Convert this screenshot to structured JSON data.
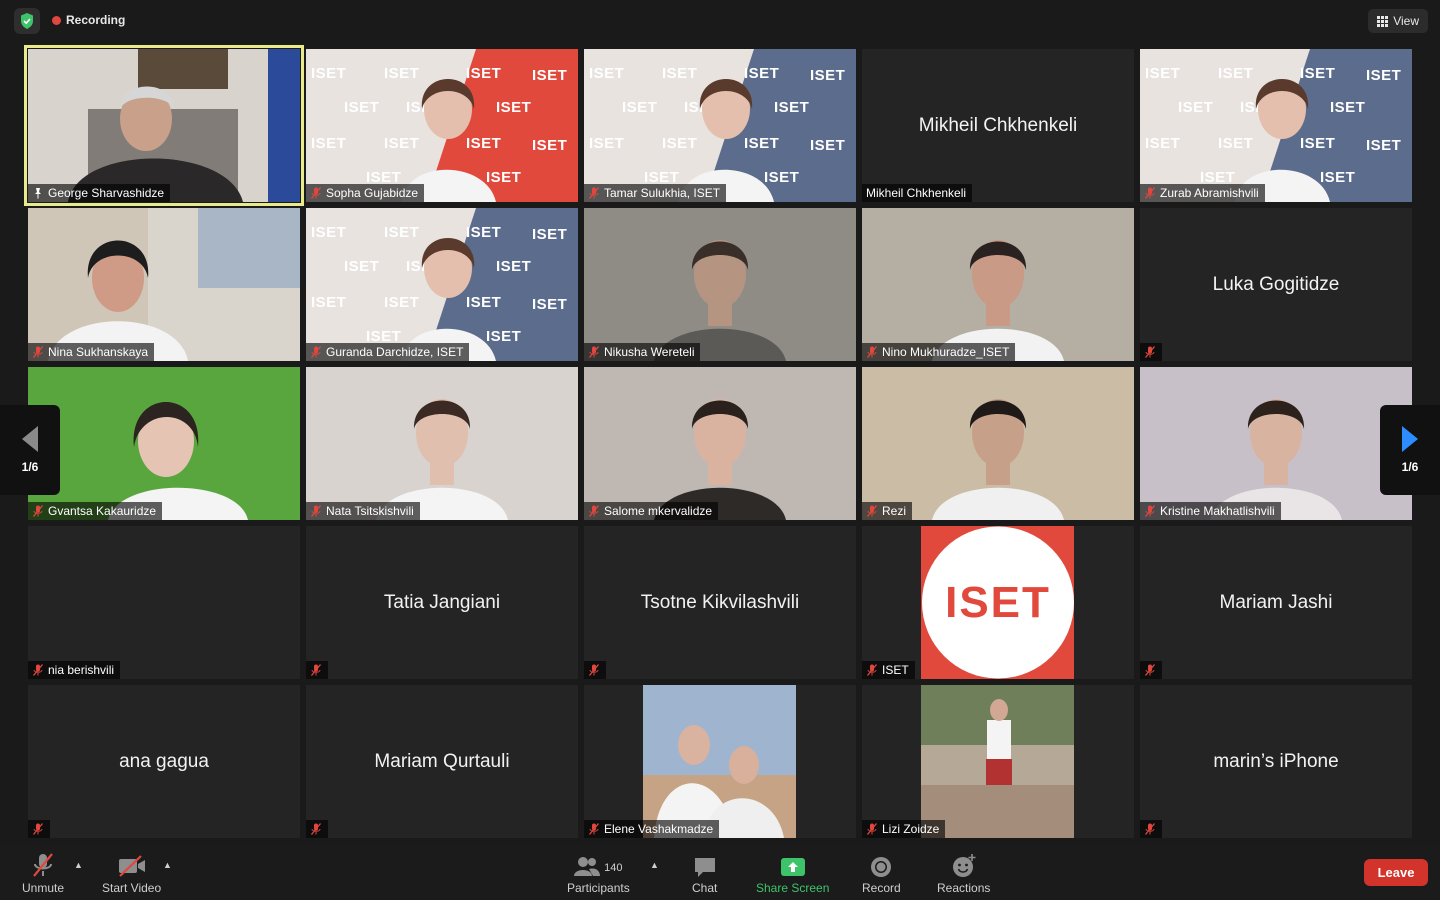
{
  "topbar": {
    "recording_label": "Recording",
    "view_label": "View"
  },
  "pagination": {
    "left": "1/6",
    "right": "1/6"
  },
  "participants": [
    {
      "name": "George Sharvashidze",
      "type": "video",
      "bg": "office",
      "active": true,
      "pin": true
    },
    {
      "name": "Sopha Gujabidze",
      "type": "video",
      "bg": "iset-red",
      "muted": true
    },
    {
      "name": "Tamar Sulukhia, ISET",
      "type": "video",
      "bg": "iset-blue",
      "muted": true
    },
    {
      "name": "Mikheil Chkhenkeli",
      "type": "name"
    },
    {
      "name": "Zurab Abramishvili",
      "type": "video",
      "bg": "iset-blue",
      "muted": true
    },
    {
      "name": "Nina Sukhanskaya",
      "type": "video",
      "bg": "room",
      "muted": true
    },
    {
      "name": "Guranda Darchidze, ISET",
      "type": "video",
      "bg": "iset-blue",
      "muted": true
    },
    {
      "name": "Nikusha Wereteli",
      "type": "video",
      "bg": "grey",
      "muted": true
    },
    {
      "name": "Nino Mukhuradze_ISET",
      "type": "video",
      "bg": "beige",
      "muted": true
    },
    {
      "name": "Luka Gogitidze",
      "type": "name",
      "muted": true,
      "hide_tag": true
    },
    {
      "name": "Gvantsa Kakauridze",
      "type": "video",
      "bg": "green",
      "muted": true
    },
    {
      "name": "Nata Tsitskishvili",
      "type": "video",
      "bg": "pale",
      "muted": true
    },
    {
      "name": "Salome mkervalidze",
      "type": "video",
      "bg": "grey2",
      "muted": true
    },
    {
      "name": "Rezi",
      "type": "video",
      "bg": "floral",
      "muted": true
    },
    {
      "name": "Kristine Makhatlishvili",
      "type": "video",
      "bg": "lilac",
      "muted": true
    },
    {
      "name": "nia berishvili",
      "type": "blank",
      "muted": true
    },
    {
      "name": "Tatia Jangiani",
      "type": "name",
      "muted": true,
      "hide_tag": true
    },
    {
      "name": "Tsotne Kikvilashvili",
      "type": "name",
      "muted": true,
      "hide_tag": true
    },
    {
      "name": "ISET",
      "type": "logo",
      "muted": true,
      "logo_text": "ISET"
    },
    {
      "name": "Mariam Jashi",
      "type": "name",
      "muted": true,
      "hide_tag": true
    },
    {
      "name": "ana gagua",
      "type": "name",
      "muted": true,
      "hide_tag": true
    },
    {
      "name": "Mariam Qurtauli",
      "type": "name",
      "muted": true,
      "hide_tag": true
    },
    {
      "name": "Elene Vashakmadze",
      "type": "photo",
      "bg": "court",
      "muted": true
    },
    {
      "name": "Lizi Zoidze",
      "type": "photo",
      "bg": "street",
      "muted": true
    },
    {
      "name": "marin’s iPhone",
      "type": "name",
      "muted": true,
      "hide_tag": true
    }
  ],
  "toolbar": {
    "unmute": "Unmute",
    "start_video": "Start Video",
    "participants": "Participants",
    "participants_count": "140",
    "chat": "Chat",
    "share_screen": "Share Screen",
    "record": "Record",
    "reactions": "Reactions",
    "leave": "Leave"
  },
  "colors": {
    "accent_green": "#3ec36b",
    "leave_red": "#d2332a",
    "active_border": "#e9ea8c",
    "iset_red": "#e0493c"
  }
}
